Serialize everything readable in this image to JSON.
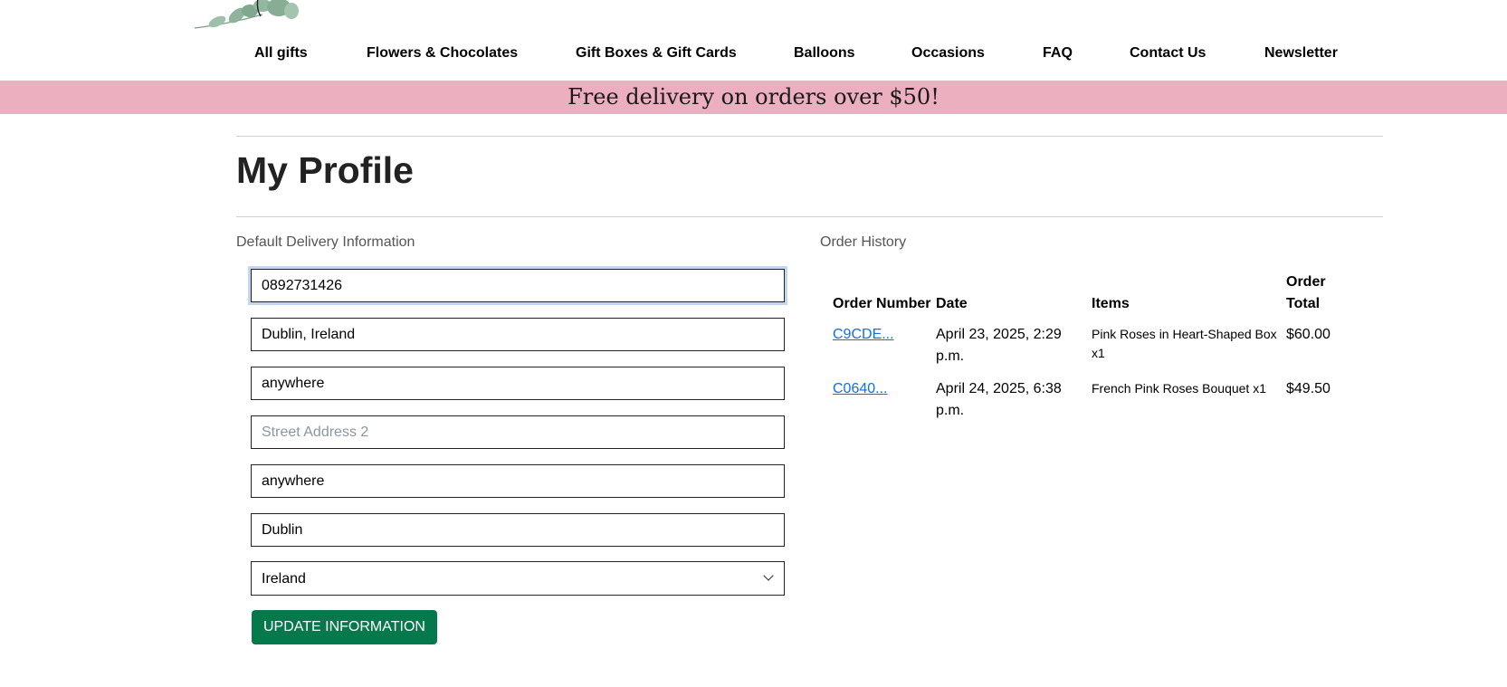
{
  "nav": [
    "All gifts",
    "Flowers & Chocolates",
    "Gift Boxes & Gift Cards",
    "Balloons",
    "Occasions",
    "FAQ",
    "Contact Us",
    "Newsletter"
  ],
  "banner": "Free delivery on orders over $50!",
  "page_title": "My Profile",
  "delivery": {
    "label": "Default Delivery Information",
    "phone": "0892731426",
    "town": "Dublin, Ireland",
    "street1": "anywhere",
    "street2_placeholder": "Street Address 2",
    "county": "anywhere",
    "postcode": "Dublin",
    "country": "Ireland",
    "button": "UPDATE INFORMATION"
  },
  "orders": {
    "label": "Order History",
    "headers": [
      "Order Number",
      "Date",
      "Items",
      "Order Total"
    ],
    "rows": [
      {
        "number": "C9CDE...",
        "date": "April 23, 2025, 2:29 p.m.",
        "items": "Pink Roses in Heart-Shaped Box x1",
        "total": "$60.00"
      },
      {
        "number": "C0640...",
        "date": "April 24, 2025, 6:38 p.m.",
        "items": "French Pink Roses Bouquet x1",
        "total": "$49.50"
      }
    ]
  },
  "colors": {
    "banner": "#ecafbf",
    "button": "#05784c",
    "link": "#0d6efd"
  }
}
